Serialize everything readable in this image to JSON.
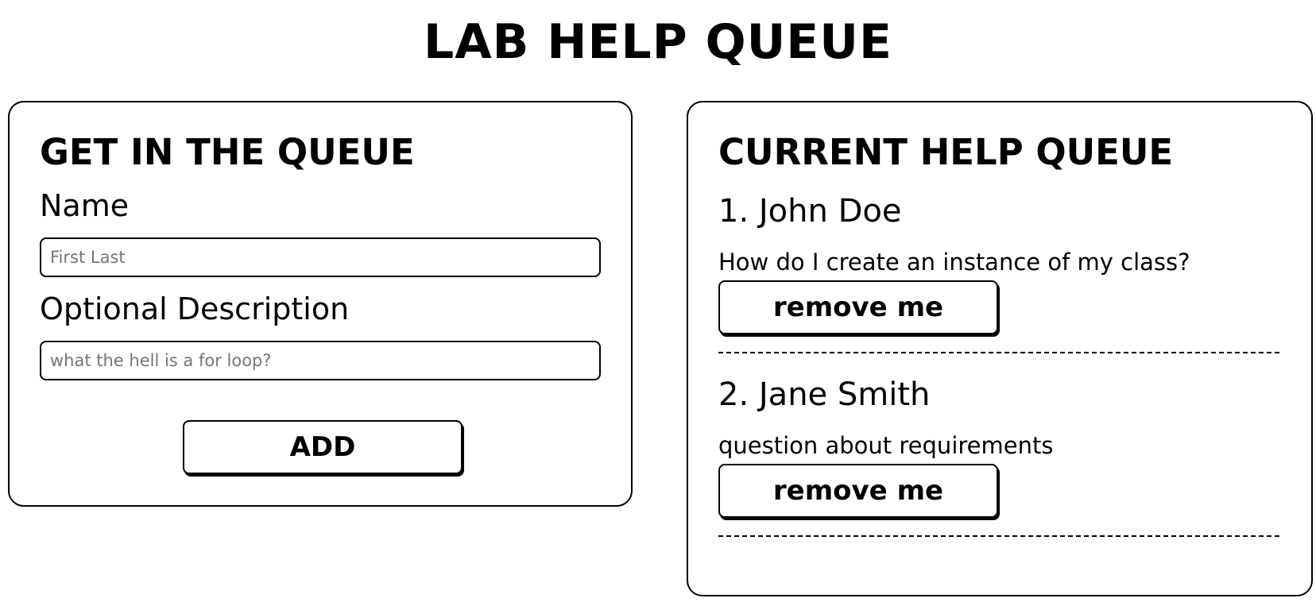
{
  "page": {
    "title": "LAB HELP QUEUE"
  },
  "form": {
    "heading": "GET IN THE QUEUE",
    "name_label": "Name",
    "name_placeholder": "First Last",
    "name_value": "",
    "description_label": "Optional Description",
    "description_placeholder": "what the hell is a for loop?",
    "description_value": "",
    "add_label": "ADD"
  },
  "queue": {
    "heading": "CURRENT HELP QUEUE",
    "remove_label": "remove me",
    "entries": [
      {
        "label": "1. John Doe",
        "description": "How do I create an instance of my class?"
      },
      {
        "label": "2. Jane Smith",
        "description": "question about requirements"
      }
    ]
  },
  "colors": {
    "background": "#ffffff",
    "text": "#000000",
    "border": "#000000",
    "placeholder": "#757575"
  }
}
